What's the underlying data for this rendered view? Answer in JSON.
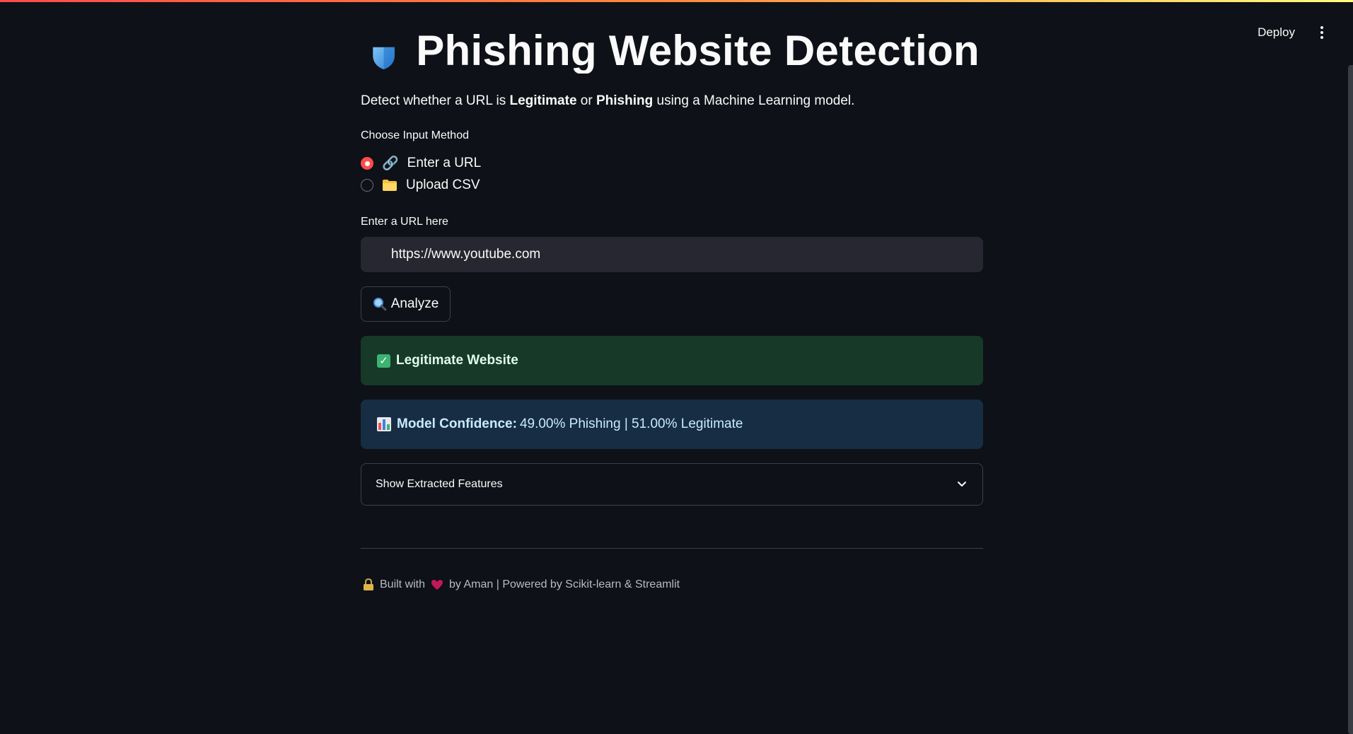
{
  "header": {
    "deploy_label": "Deploy",
    "menu_icon": "more-vertical-icon"
  },
  "main": {
    "title_icon": "shield-icon",
    "title": "Phishing Website Detection",
    "description": {
      "prefix": "Detect whether a URL is ",
      "legit": "Legitimate",
      "or": " or ",
      "phish": "Phishing",
      "suffix": " using a Machine Learning model."
    },
    "input_method": {
      "label": "Choose Input Method",
      "options": [
        {
          "icon": "link-icon",
          "label": "Enter a URL",
          "checked": true
        },
        {
          "icon": "folder-icon",
          "label": "Upload CSV",
          "checked": false
        }
      ]
    },
    "url_field": {
      "label": "Enter a URL here",
      "value": "https://www.youtube.com"
    },
    "analyze_button": {
      "icon": "magnifier-icon",
      "label": "Analyze"
    },
    "result": {
      "icon": "check-box-icon",
      "label": "Legitimate Website",
      "color": "#173928"
    },
    "confidence": {
      "icon": "bar-chart-icon",
      "label": "Model Confidence:",
      "value": "49.00% Phishing | 51.00% Legitimate",
      "color": "#172d43"
    },
    "expander": {
      "label": "Show Extracted Features",
      "icon": "chevron-down-icon"
    }
  },
  "footer": {
    "lock_icon": "lock-icon",
    "built_with": "Built with",
    "heart_icon": "heart-icon",
    "credits": "by Aman | Powered by Scikit-learn & Streamlit"
  },
  "colors": {
    "background": "#0e1117",
    "accent": "#ff4b4b",
    "input_bg": "#262730"
  }
}
